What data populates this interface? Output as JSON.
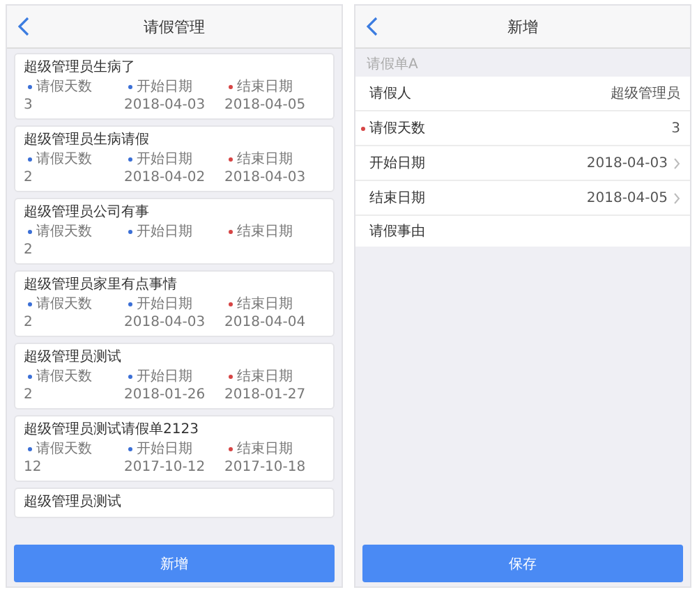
{
  "left_screen": {
    "title": "请假管理",
    "cards": [
      {
        "title": "超级管理员生病了",
        "fields": [
          {
            "label": "请假天数",
            "color": "#3b6fd6",
            "value": "3"
          },
          {
            "label": "开始日期",
            "color": "#3b6fd6",
            "value": "2018-04-03"
          },
          {
            "label": "结束日期",
            "color": "#d64545",
            "value": "2018-04-05"
          }
        ]
      },
      {
        "title": "超级管理员生病请假",
        "fields": [
          {
            "label": "请假天数",
            "color": "#3b6fd6",
            "value": "2"
          },
          {
            "label": "开始日期",
            "color": "#3b6fd6",
            "value": "2018-04-02"
          },
          {
            "label": "结束日期",
            "color": "#d64545",
            "value": "2018-04-03"
          }
        ]
      },
      {
        "title": "超级管理员公司有事",
        "fields": [
          {
            "label": "请假天数",
            "color": "#3b6fd6",
            "value": "2"
          },
          {
            "label": "开始日期",
            "color": "#3b6fd6"
          },
          {
            "label": "结束日期",
            "color": "#d64545"
          }
        ]
      },
      {
        "title": "超级管理员家里有点事情",
        "fields": [
          {
            "label": "请假天数",
            "color": "#3b6fd6",
            "value": "2"
          },
          {
            "label": "开始日期",
            "color": "#3b6fd6",
            "value": "2018-04-03"
          },
          {
            "label": "结束日期",
            "color": "#d64545",
            "value": "2018-04-04"
          }
        ]
      },
      {
        "title": "超级管理员测试",
        "fields": [
          {
            "label": "请假天数",
            "color": "#3b6fd6",
            "value": "2"
          },
          {
            "label": "开始日期",
            "color": "#3b6fd6",
            "value": "2018-01-26"
          },
          {
            "label": "结束日期",
            "color": "#d64545",
            "value": "2018-01-27"
          }
        ]
      },
      {
        "title": "超级管理员测试请假单2123",
        "fields": [
          {
            "label": "请假天数",
            "color": "#3b6fd6",
            "value": "12"
          },
          {
            "label": "开始日期",
            "color": "#3b6fd6",
            "value": "2017-10-12"
          },
          {
            "label": "结束日期",
            "color": "#d64545",
            "value": "2017-10-18"
          }
        ]
      },
      {
        "title": "超级管理员测试"
      }
    ],
    "button": "新增"
  },
  "right_screen": {
    "title": "新增",
    "section": "请假单A",
    "rows": [
      {
        "label": "请假人",
        "value": "超级管理员",
        "required": false,
        "kind": "text"
      },
      {
        "label": "请假天数",
        "value": "3",
        "required": true,
        "kind": "text"
      },
      {
        "label": "开始日期",
        "value": "2018-04-03",
        "required": false,
        "kind": "picker"
      },
      {
        "label": "结束日期",
        "value": "2018-04-05",
        "required": false,
        "kind": "picker"
      },
      {
        "label": "请假事由",
        "required": false,
        "kind": "textarea"
      }
    ],
    "button": "保存"
  }
}
